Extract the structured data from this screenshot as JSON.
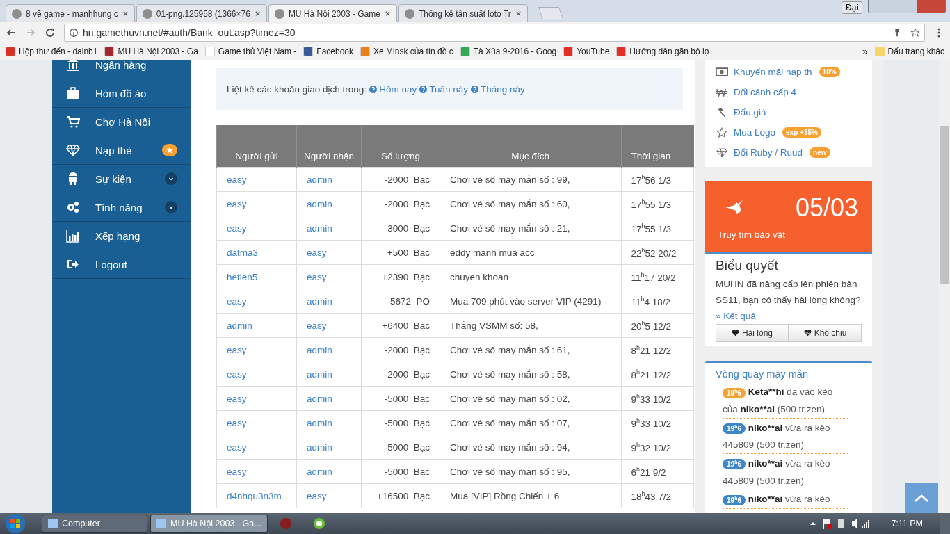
{
  "browser": {
    "tabs": [
      {
        "title": "8 vẽ game - manhhung c",
        "selected": false
      },
      {
        "title": "01-png.125958 (1366×76",
        "selected": false
      },
      {
        "title": "MU Hà Nội 2003 - Game",
        "selected": true
      },
      {
        "title": "Thống kê tần suất loto Tr",
        "selected": false
      }
    ],
    "profile": "Đại",
    "address": "hn.gamethuvn.net/#auth/Bank_out.asp?timez=30",
    "bookmarks": [
      {
        "label": "Hộp thư đến - dainb1"
      },
      {
        "label": "MU Hà Nội 2003 - Ga"
      },
      {
        "label": "Game thủ Việt Nam -"
      },
      {
        "label": "Facebook"
      },
      {
        "label": "Xe Minsk của tín đồ c"
      },
      {
        "label": "Tà Xùa 9-2016 - Goog"
      },
      {
        "label": "YouTube"
      },
      {
        "label": "Hướng dẫn gắn bộ lọ"
      }
    ],
    "more": "»",
    "other_bookmarks": "Dấu trang khác"
  },
  "sidebar": {
    "items": [
      {
        "label": "Ngân hàng",
        "kind": "plain"
      },
      {
        "label": "Hòm đồ ảo",
        "kind": "plain"
      },
      {
        "label": "Chợ Hà Nội",
        "kind": "plain"
      },
      {
        "label": "Nạp thẻ",
        "kind": "star"
      },
      {
        "label": "Sự kiện",
        "kind": "dropdown"
      },
      {
        "label": "Tính năng",
        "kind": "dropdown"
      },
      {
        "label": "Xếp hạng",
        "kind": "plain"
      },
      {
        "label": "Logout",
        "kind": "plain"
      }
    ]
  },
  "filter": {
    "label": "Liệt kê các khoản giao dịch trong:",
    "links": [
      "Hôm nay",
      "Tuần này",
      "Tháng này"
    ]
  },
  "table": {
    "columns": [
      "Người gửi",
      "Người nhận",
      "Số lượng",
      "Mục đích",
      "Thời gian"
    ],
    "rows": [
      {
        "sender": "easy",
        "receiver": "admin",
        "amount": "-2000",
        "unit": "Bạc",
        "purpose": "Chơi vé số may mắn số : 99,",
        "time": "17$^{h}$56 1/3"
      },
      {
        "sender": "easy",
        "receiver": "admin",
        "amount": "-2000",
        "unit": "Bạc",
        "purpose": "Chơi vé số may mắn số : 60,",
        "time": "17$^{h}$55 1/3"
      },
      {
        "sender": "easy",
        "receiver": "admin",
        "amount": "-3000",
        "unit": "Bạc",
        "purpose": "Chơi vé số may mắn số : 21,",
        "time": "17$^{h}$55 1/3"
      },
      {
        "sender": "datma3",
        "receiver": "easy",
        "amount": "+500",
        "unit": "Bạc",
        "purpose": "eddy manh mua acc",
        "time": "22$^{h}$52 20/2"
      },
      {
        "sender": "hetien5",
        "receiver": "easy",
        "amount": "+2390",
        "unit": "Bạc",
        "purpose": "chuyen khoan",
        "time": "11$^{h}$17 20/2"
      },
      {
        "sender": "easy",
        "receiver": "admin",
        "amount": "-5672",
        "unit": "PO",
        "purpose": "Mua 709 phút vào server VIP (4291)",
        "time": "11$^{h}$4 18/2"
      },
      {
        "sender": "admin",
        "receiver": "easy",
        "amount": "+6400",
        "unit": "Bạc",
        "purpose": "Thắng VSMM số: 58,",
        "time": "20$^{h}$5 12/2"
      },
      {
        "sender": "easy",
        "receiver": "admin",
        "amount": "-2000",
        "unit": "Bạc",
        "purpose": "Chơi vé số may mắn số : 61,",
        "time": "8$^{h}$21 12/2"
      },
      {
        "sender": "easy",
        "receiver": "admin",
        "amount": "-2000",
        "unit": "Bạc",
        "purpose": "Chơi vé số may mắn số : 58,",
        "time": "8$^{h}$21 12/2"
      },
      {
        "sender": "easy",
        "receiver": "admin",
        "amount": "-5000",
        "unit": "Bạc",
        "purpose": "Chơi vé số may mắn số : 02,",
        "time": "9$^{h}$33 10/2"
      },
      {
        "sender": "easy",
        "receiver": "admin",
        "amount": "-5000",
        "unit": "Bạc",
        "purpose": "Chơi vé số may mắn số : 07,",
        "time": "9$^{h}$33 10/2"
      },
      {
        "sender": "easy",
        "receiver": "admin",
        "amount": "-5000",
        "unit": "Bạc",
        "purpose": "Chơi vé số may mắn số : 94,",
        "time": "9$^{h}$32 10/2"
      },
      {
        "sender": "easy",
        "receiver": "admin",
        "amount": "-5000",
        "unit": "Bạc",
        "purpose": "Chơi vé số may mắn số : 95,",
        "time": "6$^{h}$21 9/2"
      },
      {
        "sender": "d4nhqu3n3m",
        "receiver": "easy",
        "amount": "+16500",
        "unit": "Bạc",
        "purpose": "Mua [VIP] Rồng Chiến + 6",
        "time": "18$^{h}$43 7/2"
      }
    ]
  },
  "menu": {
    "items": [
      {
        "label": "Khuyến mãi nạp th",
        "badge": "10%"
      },
      {
        "label": "Đổi cánh cấp 4"
      },
      {
        "label": "Đấu giá"
      },
      {
        "label": "Mua Logo",
        "badge": "exp +35%"
      },
      {
        "label": "Đổi Ruby / Ruud",
        "badge": "new"
      }
    ]
  },
  "event": {
    "date": "05/03",
    "label": "Truy tìm bảo vật"
  },
  "poll": {
    "title": "Biểu quyết",
    "text": "MUHN đã nâng cấp lên phiên bản SS11, bạn có thấy hài lòng không?",
    "link": "» Kết quả",
    "buttons": [
      "Hài lòng",
      "Khó chịu"
    ]
  },
  "wheel": {
    "title": "Vòng quay may mắn",
    "items": [
      {
        "time": "19$^{h}$6",
        "color": "#f7a133",
        "parts": [
          {
            "text": "Keta**hi",
            "bold": true
          },
          {
            "text": " đã vào kèo của ",
            "bold": false
          },
          {
            "text": "niko**ai",
            "bold": true
          },
          {
            "text": " (500 tr.zen)",
            "bold": false
          }
        ]
      },
      {
        "time": "19$^{h}$6",
        "color": "#3d87c9",
        "parts": [
          {
            "text": "niko**ai",
            "bold": true
          },
          {
            "text": " vừa ra kèo 445809 (500 tr.zen)",
            "bold": false
          }
        ]
      },
      {
        "time": "19$^{h}$6",
        "color": "#3d87c9",
        "parts": [
          {
            "text": "niko**ai",
            "bold": true
          },
          {
            "text": " vừa ra kèo 445809 (500 tr.zen)",
            "bold": false
          }
        ]
      },
      {
        "time": "19$^{h}$6",
        "color": "#3d87c9",
        "parts": [
          {
            "text": "niko**ai",
            "bold": true
          },
          {
            "text": " vừa ra kèo",
            "bold": false
          }
        ]
      }
    ]
  },
  "taskbar": {
    "tasks": [
      {
        "label": "Computer",
        "selected": false
      },
      {
        "label": "MU Hà Nội 2003 - Ga...",
        "selected": true
      }
    ],
    "clock": "7:11 PM"
  }
}
